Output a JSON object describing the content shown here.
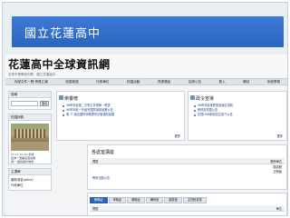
{
  "banner": {
    "title": "國立花蓮高中"
  },
  "site": {
    "title": "花蓮高中全球資訊網",
    "subtitle": "全球不是學校列表 · 國立花蓮高中"
  },
  "nav": {
    "items": [
      "內部文件一覽·會員汇總",
      "校園首頁",
      "行政單位",
      "校園活動",
      "資源連結",
      "名師公告",
      "登入",
      "網站",
      "系統帮助"
    ]
  },
  "left": {
    "search_head": "搜尋",
    "search_placeholder": "",
    "search_button": "搜尋",
    "photo_head": "校園掠影",
    "photo_date": "97.11.10-20 幸福",
    "photo_caption_1": "班導一選舉競選演講",
    "photo_caption_2": "導一-副班長於佈置",
    "links_head": "主選單",
    "links": [
      "最新消息(phirs)",
      "行政單位"
    ]
  },
  "news": {
    "title": "榮譽榜",
    "items": [
      "96學年度第二次學生會選舉一覽表",
      "96學年度一年級會國際演講競賽公告",
      "第 ?? 屆全國科學展覽會初審通知結果"
    ],
    "more": "更多"
  },
  "admin": {
    "title": "政令宣導",
    "items": [
      "96學年度推薦甄選報名須知",
      "教育部重要公告",
      "花蓮HSN新版招生簡介公告"
    ],
    "more": "更多"
  },
  "bulletin": {
    "title": "各處室講座",
    "col_title": "標題",
    "col_unit": "發佈單位",
    "row_title": "教研活動公告",
    "row_unit_1": "圖書館",
    "row_unit_2": "註冊組"
  },
  "tabs": {
    "items": [
      "教務處",
      "學務處",
      "總務處",
      "輔導室",
      "圖書館",
      "主任秘書室"
    ],
    "col_title": "標題",
    "col_unit": "單位"
  }
}
